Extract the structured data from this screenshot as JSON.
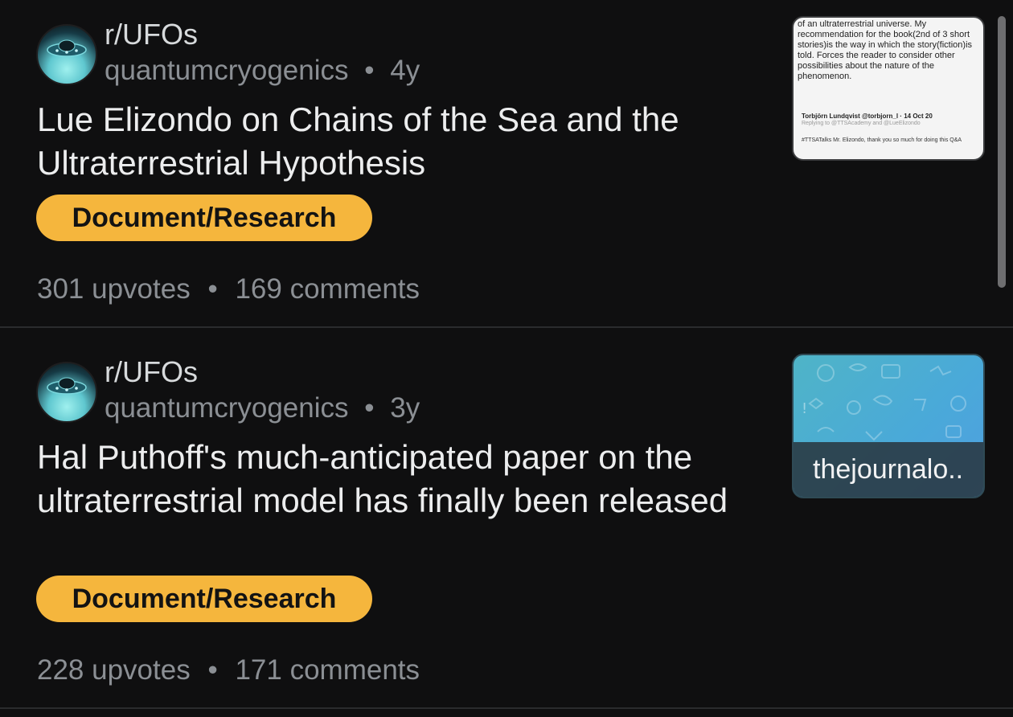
{
  "posts": [
    {
      "subreddit": "r/UFOs",
      "author": "quantumcryogenics",
      "age": "4y",
      "separator": "•",
      "title": "Lue Elizondo on Chains of the Sea and the Ultraterrestrial Hypothesis",
      "flair": "Document/Research",
      "upvotes": "301 upvotes",
      "comments": "169 comments",
      "thumbnail": {
        "main_text": "of an ultraterrestrial universe. My recommendation for the book(2nd of 3 short stories)is the way in which the story(fiction)is told. Forces the reader to consider other possibilities about the nature of the phenomenon.",
        "author": "Torbjörn Lundqvist @torbjorn_l · 14 Oct 20",
        "reply": "Replying to @TTSAcademy and @LueElizondo",
        "body": "#TTSATalks Mr. Elizondo, thank you so much for doing this Q&A"
      }
    },
    {
      "subreddit": "r/UFOs",
      "author": "quantumcryogenics",
      "age": "3y",
      "separator": "•",
      "title": "Hal Puthoff's much-anticipated paper on the ultraterrestrial model has finally been released",
      "flair": "Document/Research",
      "upvotes": "228 upvotes",
      "comments": "171 comments",
      "thumbnail": {
        "label": "thejournalo..",
        "icon": "link-preview-pattern"
      }
    }
  ],
  "colors": {
    "background": "#0f0f10",
    "flair": "#f5b63d",
    "muted_text": "#8b8f94"
  }
}
